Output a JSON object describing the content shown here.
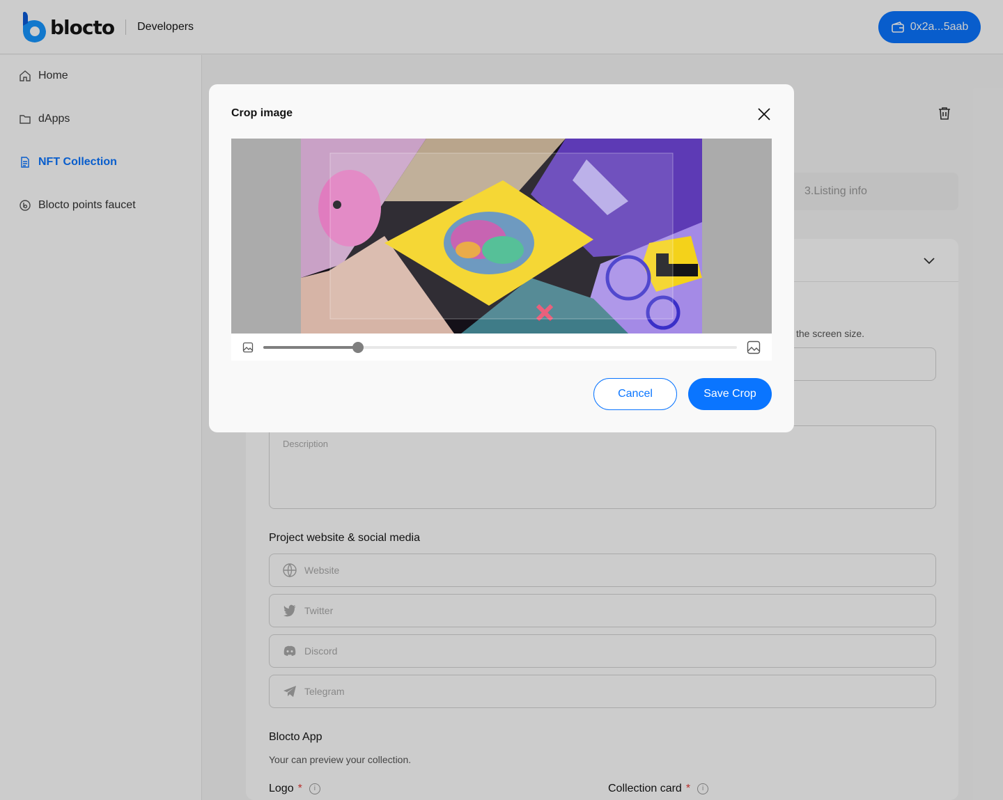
{
  "header": {
    "brand": "blocto",
    "subtitle": "Developers",
    "wallet_address": "0x2a...5aab"
  },
  "sidebar": {
    "items": [
      {
        "label": "Home",
        "icon": "home-icon"
      },
      {
        "label": "dApps",
        "icon": "folder-icon"
      },
      {
        "label": "NFT Collection",
        "icon": "document-icon",
        "active": true
      },
      {
        "label": "Blocto points faucet",
        "icon": "blocto-coin-icon"
      }
    ]
  },
  "main": {
    "step3_label": "3.Listing info",
    "screen_hint": "the screen size.",
    "description_placeholder": "Description",
    "social_title": "Project website & social media",
    "social": {
      "website": "Website",
      "twitter": "Twitter",
      "discord": "Discord",
      "telegram": "Telegram"
    },
    "app_title": "Blocto App",
    "app_sub": "Your can preview your collection.",
    "logo_label": "Logo",
    "card_label": "Collection card",
    "required_mark": "*",
    "info_mark": "i"
  },
  "modal": {
    "title": "Crop image",
    "zoom_fraction": 0.2,
    "cancel_label": "Cancel",
    "save_label": "Save Crop"
  },
  "colors": {
    "accent": "#0a75ff",
    "required": "#e53935"
  }
}
